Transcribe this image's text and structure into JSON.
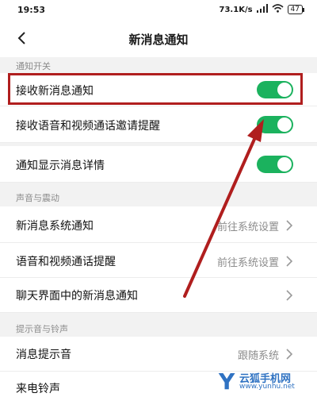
{
  "status_bar": {
    "time": "19:53",
    "network_speed": "73.1K/s",
    "battery": "47"
  },
  "header": {
    "title": "新消息通知"
  },
  "sections": {
    "notification_switch": "通知开关",
    "sound_vibration": "声音与震动",
    "tone_ringtone": "提示音与铃声"
  },
  "rows": {
    "receive_new": {
      "label": "接收新消息通知",
      "enabled": true
    },
    "voice_video_invite": {
      "label": "接收语音和视频通话邀请提醒",
      "enabled": true
    },
    "show_details": {
      "label": "通知显示消息详情",
      "enabled": true
    },
    "system_notify": {
      "label": "新消息系统通知",
      "value": "前往系统设置"
    },
    "call_remind": {
      "label": "语音和视频通话提醒",
      "value": "前往系统设置"
    },
    "chat_notify": {
      "label": "聊天界面中的新消息通知"
    },
    "message_tone": {
      "label": "消息提示音",
      "value": "跟随系统"
    },
    "ringtone": {
      "label": "来电铃声"
    }
  },
  "colors": {
    "toggle_on": "#1bb25e",
    "highlight": "#b01e1e",
    "arrow": "#b01e1e"
  },
  "watermark": {
    "letter": "Y",
    "name": "云狐手机网",
    "url": "www.yunhu.net"
  }
}
